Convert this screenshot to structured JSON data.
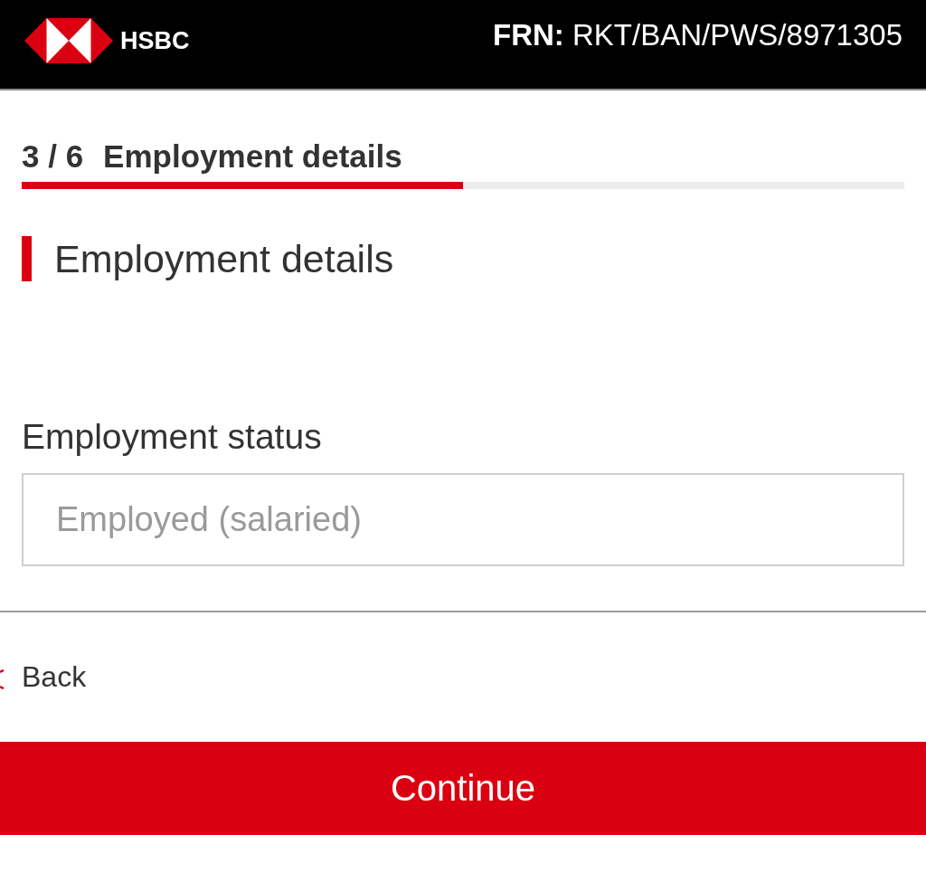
{
  "header": {
    "brand": "HSBC",
    "reference": "**FRN:** RKT/BAN/PWS/8971305"
  },
  "progress": {
    "step": "3 / 6",
    "title": "Employment details",
    "level": 0.5
  },
  "section": {
    "title": "Employment details"
  },
  "fields": [
    {
      "label": "Employment status",
      "value": "Employed (salaried)",
      "disabled": true
    }
  ],
  "back": {
    "label": "Back"
  },
  "continue_button": {
    "label": "Continue"
  }
}
